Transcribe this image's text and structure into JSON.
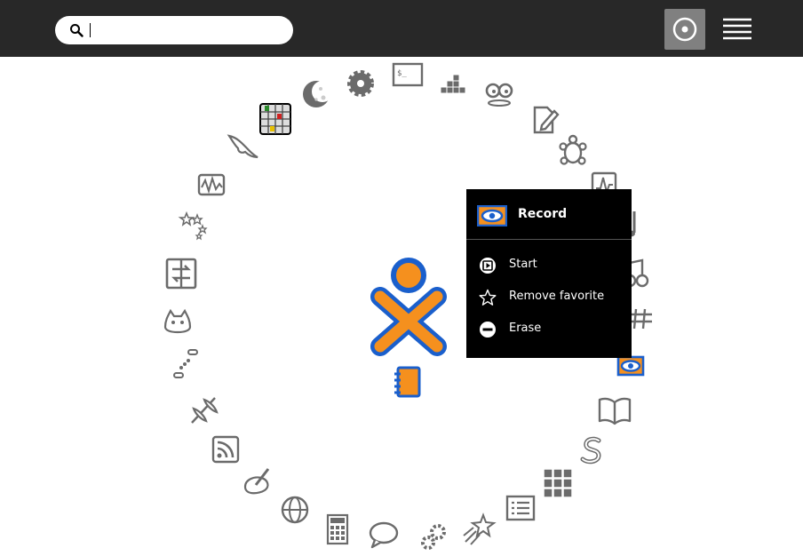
{
  "toolbar": {
    "search": {
      "value": "",
      "icon": "search-icon"
    },
    "views": [
      {
        "name": "favorites-view",
        "selected": true
      },
      {
        "name": "list-view",
        "selected": false
      }
    ]
  },
  "ring": {
    "icons": [
      "write-icon",
      "turtle-icon",
      "measure-icon",
      "music-icon",
      "tuner-icon",
      "fiddle-icon",
      "record-icon",
      "read-icon",
      "snake-icon",
      "blocks-icon",
      "list-icon",
      "shooting-star-icon",
      "gears-icon",
      "chat-icon",
      "calculator-icon",
      "browse-icon",
      "paint-icon",
      "news-reader-icon",
      "kite-icon",
      "dots-icon",
      "cat-icon",
      "portfolio-icon",
      "stars-icon",
      "oscilloscope-icon",
      "dolphin-icon",
      "maze-board-icon",
      "moon-icon",
      "settings-icon",
      "terminal-icon",
      "tetris-icon",
      "eyes-icon"
    ]
  },
  "center": {
    "xo_icon": "xo-person-icon",
    "journal_icon": "journal-icon"
  },
  "palette": {
    "title": "Record",
    "title_icon": "record-icon",
    "items": [
      {
        "label": "Start",
        "icon": "start-icon"
      },
      {
        "label": "Remove favorite",
        "icon": "star-icon"
      },
      {
        "label": "Erase",
        "icon": "erase-icon"
      }
    ]
  },
  "colors": {
    "toolbar_bg": "#282828",
    "xo_stroke": "#1a5fcc",
    "xo_fill": "#f5901e",
    "icon_gray": "#6b6b6b",
    "palette_bg": "#000000"
  }
}
